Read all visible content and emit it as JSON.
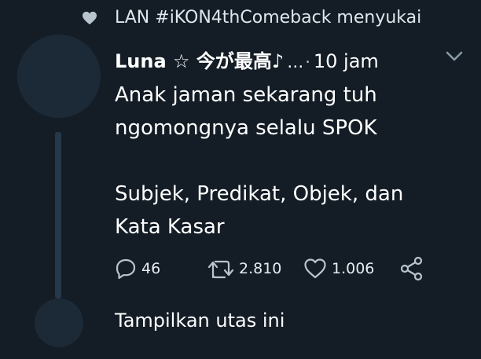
{
  "social_context": {
    "icon": "heart-icon",
    "text": "LAN #iKON4thComeback menyukai"
  },
  "tweet": {
    "display_name": "Luna ☆ 今が最高♪",
    "ellipsis": "…",
    "separator": "·",
    "time": "10 jam",
    "text": "Anak jaman sekarang tuh\nngomongnya selalu SPOK\n\nSubjek, Predikat, Objek, dan\nKata Kasar",
    "actions": {
      "replies": "46",
      "retweets": "2.810",
      "likes": "1.006"
    }
  },
  "show_thread_label": "Tampilkan utas ini",
  "colors": {
    "background": "#141d26",
    "avatar": "#1c2a38",
    "icon_gray": "#b8c4ce"
  }
}
